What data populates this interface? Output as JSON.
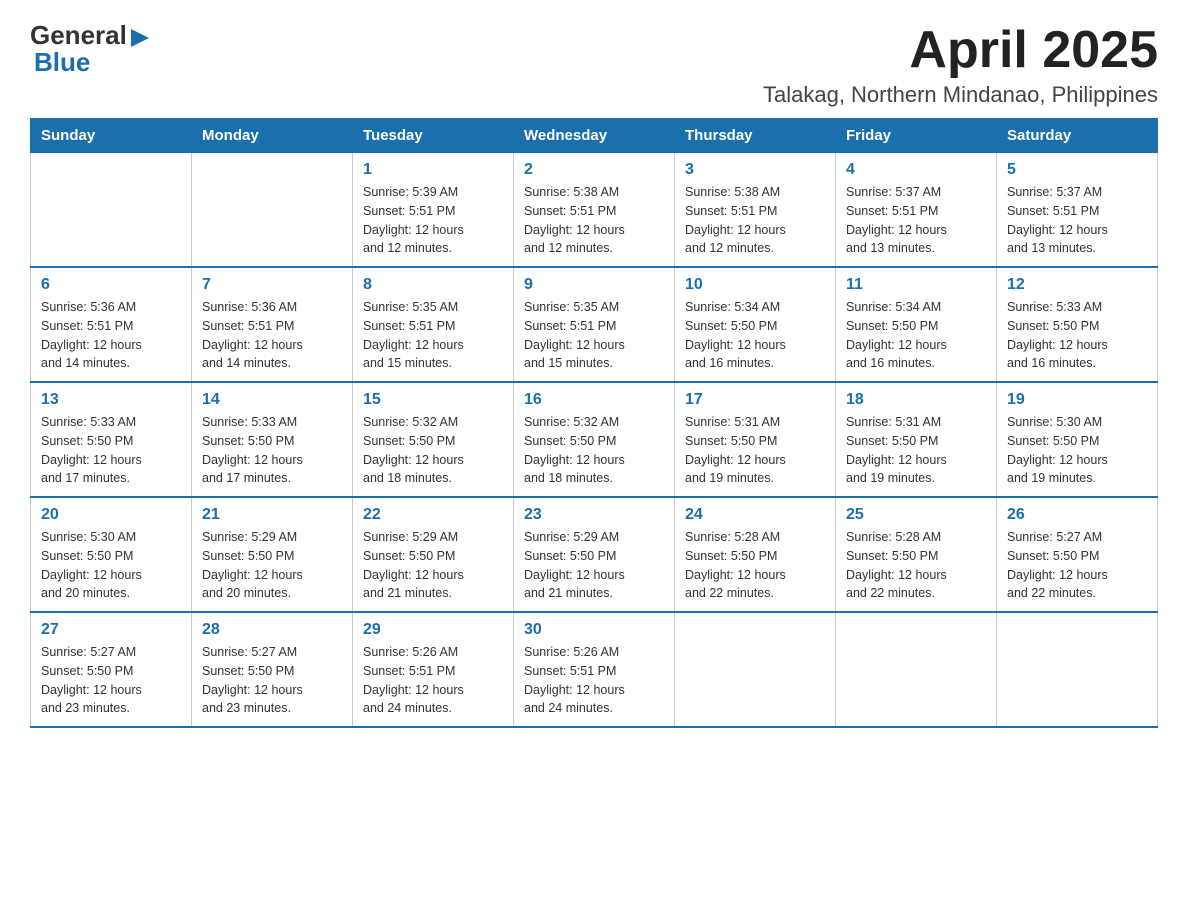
{
  "header": {
    "logo_general": "General",
    "logo_blue": "Blue",
    "title": "April 2025",
    "subtitle": "Talakag, Northern Mindanao, Philippines"
  },
  "calendar": {
    "days_of_week": [
      "Sunday",
      "Monday",
      "Tuesday",
      "Wednesday",
      "Thursday",
      "Friday",
      "Saturday"
    ],
    "weeks": [
      [
        {
          "day": "",
          "info": ""
        },
        {
          "day": "",
          "info": ""
        },
        {
          "day": "1",
          "info": "Sunrise: 5:39 AM\nSunset: 5:51 PM\nDaylight: 12 hours\nand 12 minutes."
        },
        {
          "day": "2",
          "info": "Sunrise: 5:38 AM\nSunset: 5:51 PM\nDaylight: 12 hours\nand 12 minutes."
        },
        {
          "day": "3",
          "info": "Sunrise: 5:38 AM\nSunset: 5:51 PM\nDaylight: 12 hours\nand 12 minutes."
        },
        {
          "day": "4",
          "info": "Sunrise: 5:37 AM\nSunset: 5:51 PM\nDaylight: 12 hours\nand 13 minutes."
        },
        {
          "day": "5",
          "info": "Sunrise: 5:37 AM\nSunset: 5:51 PM\nDaylight: 12 hours\nand 13 minutes."
        }
      ],
      [
        {
          "day": "6",
          "info": "Sunrise: 5:36 AM\nSunset: 5:51 PM\nDaylight: 12 hours\nand 14 minutes."
        },
        {
          "day": "7",
          "info": "Sunrise: 5:36 AM\nSunset: 5:51 PM\nDaylight: 12 hours\nand 14 minutes."
        },
        {
          "day": "8",
          "info": "Sunrise: 5:35 AM\nSunset: 5:51 PM\nDaylight: 12 hours\nand 15 minutes."
        },
        {
          "day": "9",
          "info": "Sunrise: 5:35 AM\nSunset: 5:51 PM\nDaylight: 12 hours\nand 15 minutes."
        },
        {
          "day": "10",
          "info": "Sunrise: 5:34 AM\nSunset: 5:50 PM\nDaylight: 12 hours\nand 16 minutes."
        },
        {
          "day": "11",
          "info": "Sunrise: 5:34 AM\nSunset: 5:50 PM\nDaylight: 12 hours\nand 16 minutes."
        },
        {
          "day": "12",
          "info": "Sunrise: 5:33 AM\nSunset: 5:50 PM\nDaylight: 12 hours\nand 16 minutes."
        }
      ],
      [
        {
          "day": "13",
          "info": "Sunrise: 5:33 AM\nSunset: 5:50 PM\nDaylight: 12 hours\nand 17 minutes."
        },
        {
          "day": "14",
          "info": "Sunrise: 5:33 AM\nSunset: 5:50 PM\nDaylight: 12 hours\nand 17 minutes."
        },
        {
          "day": "15",
          "info": "Sunrise: 5:32 AM\nSunset: 5:50 PM\nDaylight: 12 hours\nand 18 minutes."
        },
        {
          "day": "16",
          "info": "Sunrise: 5:32 AM\nSunset: 5:50 PM\nDaylight: 12 hours\nand 18 minutes."
        },
        {
          "day": "17",
          "info": "Sunrise: 5:31 AM\nSunset: 5:50 PM\nDaylight: 12 hours\nand 19 minutes."
        },
        {
          "day": "18",
          "info": "Sunrise: 5:31 AM\nSunset: 5:50 PM\nDaylight: 12 hours\nand 19 minutes."
        },
        {
          "day": "19",
          "info": "Sunrise: 5:30 AM\nSunset: 5:50 PM\nDaylight: 12 hours\nand 19 minutes."
        }
      ],
      [
        {
          "day": "20",
          "info": "Sunrise: 5:30 AM\nSunset: 5:50 PM\nDaylight: 12 hours\nand 20 minutes."
        },
        {
          "day": "21",
          "info": "Sunrise: 5:29 AM\nSunset: 5:50 PM\nDaylight: 12 hours\nand 20 minutes."
        },
        {
          "day": "22",
          "info": "Sunrise: 5:29 AM\nSunset: 5:50 PM\nDaylight: 12 hours\nand 21 minutes."
        },
        {
          "day": "23",
          "info": "Sunrise: 5:29 AM\nSunset: 5:50 PM\nDaylight: 12 hours\nand 21 minutes."
        },
        {
          "day": "24",
          "info": "Sunrise: 5:28 AM\nSunset: 5:50 PM\nDaylight: 12 hours\nand 22 minutes."
        },
        {
          "day": "25",
          "info": "Sunrise: 5:28 AM\nSunset: 5:50 PM\nDaylight: 12 hours\nand 22 minutes."
        },
        {
          "day": "26",
          "info": "Sunrise: 5:27 AM\nSunset: 5:50 PM\nDaylight: 12 hours\nand 22 minutes."
        }
      ],
      [
        {
          "day": "27",
          "info": "Sunrise: 5:27 AM\nSunset: 5:50 PM\nDaylight: 12 hours\nand 23 minutes."
        },
        {
          "day": "28",
          "info": "Sunrise: 5:27 AM\nSunset: 5:50 PM\nDaylight: 12 hours\nand 23 minutes."
        },
        {
          "day": "29",
          "info": "Sunrise: 5:26 AM\nSunset: 5:51 PM\nDaylight: 12 hours\nand 24 minutes."
        },
        {
          "day": "30",
          "info": "Sunrise: 5:26 AM\nSunset: 5:51 PM\nDaylight: 12 hours\nand 24 minutes."
        },
        {
          "day": "",
          "info": ""
        },
        {
          "day": "",
          "info": ""
        },
        {
          "day": "",
          "info": ""
        }
      ]
    ]
  }
}
